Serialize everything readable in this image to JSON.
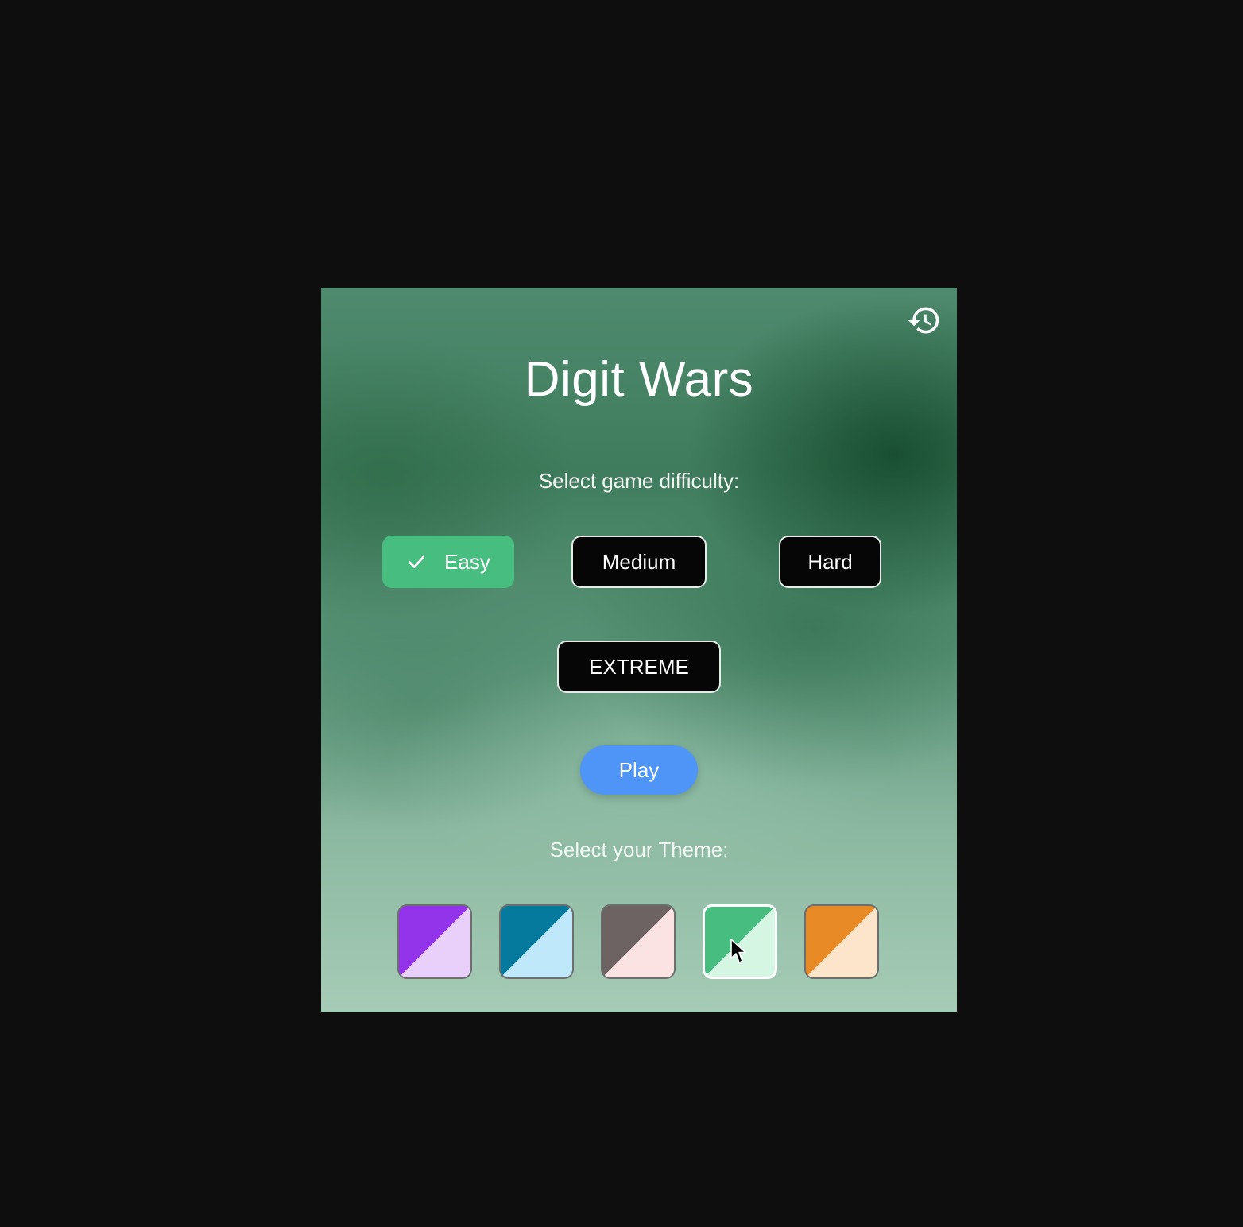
{
  "app": {
    "title": "Digit Wars"
  },
  "header": {
    "history_icon": "history-icon"
  },
  "difficulty": {
    "prompt": "Select game difficulty:",
    "options": [
      {
        "label": "Easy",
        "selected": true
      },
      {
        "label": "Medium",
        "selected": false
      },
      {
        "label": "Hard",
        "selected": false
      },
      {
        "label": "EXTREME",
        "selected": false
      }
    ],
    "check_icon": "check-icon"
  },
  "play": {
    "label": "Play"
  },
  "theme": {
    "prompt": "Select your Theme:",
    "swatches": [
      {
        "name": "purple",
        "primary": "#9333ea",
        "secondary": "#e9d0fb",
        "selected": false
      },
      {
        "name": "blue",
        "primary": "#067a9c",
        "secondary": "#bfe8fb",
        "selected": false
      },
      {
        "name": "brown",
        "primary": "#6e6363",
        "secondary": "#fbe3e3",
        "selected": false
      },
      {
        "name": "green",
        "primary": "#47bd80",
        "secondary": "#d6f6e4",
        "selected": true
      },
      {
        "name": "orange",
        "primary": "#e88b26",
        "secondary": "#fde5cc",
        "selected": false
      }
    ]
  },
  "colors": {
    "selected_difficulty": "#47bd80",
    "unselected_difficulty": "#060606",
    "play_button": "#4f94f7",
    "background": "#0e0e0f"
  }
}
